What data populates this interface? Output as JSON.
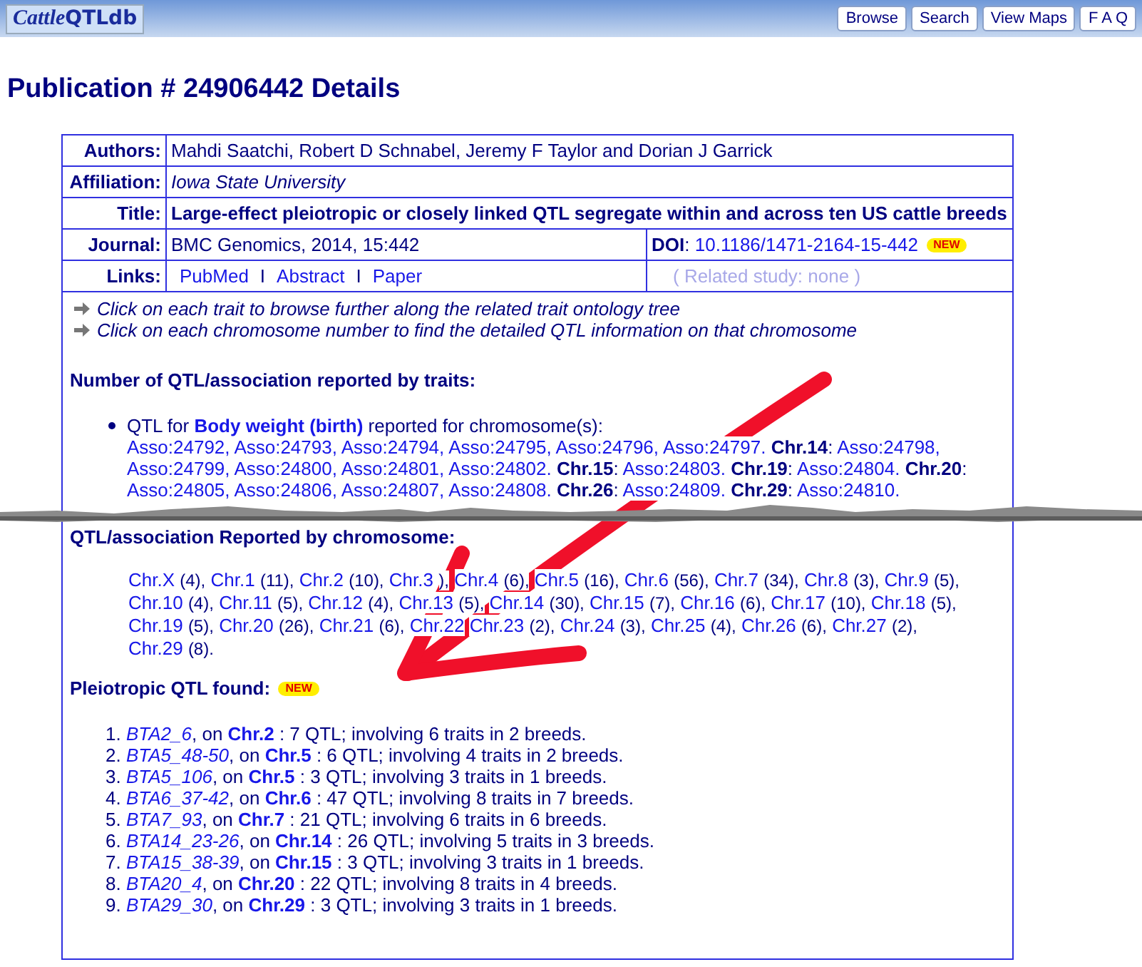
{
  "header": {
    "logo": [
      "Cattle",
      "QTLdb"
    ],
    "nav": [
      "Browse",
      "Search",
      "View Maps",
      "F A Q"
    ]
  },
  "page_title": "Publication # 24906442 Details",
  "details": {
    "authors": {
      "label": "Authors:",
      "value": "Mahdi Saatchi, Robert D Schnabel, Jeremy F Taylor and Dorian J Garrick"
    },
    "affiliation": {
      "label": "Affiliation:",
      "value": "Iowa State University"
    },
    "title": {
      "label": "Title:",
      "value": "Large-effect pleiotropic or closely linked QTL segregate within and across ten US cattle breeds"
    },
    "journal": {
      "label": "Journal:",
      "value": "BMC Genomics, 2014, 15:442"
    },
    "doi": {
      "label": "DOI",
      "colon": ":",
      "value": "10.1186/1471-2164-15-442",
      "badge": "NEW"
    },
    "links": {
      "label": "Links:",
      "items": [
        {
          "label": "PubMed"
        },
        {
          "separator": "I",
          "label": "Abstract"
        },
        {
          "separator": "I",
          "label": "Paper"
        }
      ],
      "related": "( Related study: none )"
    }
  },
  "instructions": [
    "Click on each trait to browse further along the related trait ontology tree",
    "Click on each chromosome number to find the detailed QTL information on that chromosome"
  ],
  "traits_section": {
    "heading": "Number of QTL/association reported by traits:",
    "prefix": "QTL for",
    "trait": "Body weight (birth)",
    "suffix": "reported for chromosome(s):",
    "groups": [
      {
        "assos": [
          "Asso:24792,",
          "Asso:24793,",
          "Asso:24794,",
          "Asso:24795,",
          "Asso:24796,",
          "Asso:24797."
        ]
      },
      {
        "chr": "Chr.14",
        "assos": [
          "Asso:24798,",
          "Asso:24799,",
          "Asso:24800,",
          "Asso:24801,",
          "Asso:24802."
        ]
      },
      {
        "chr": "Chr.15",
        "assos": [
          "Asso:24803."
        ]
      },
      {
        "chr": "Chr.19",
        "assos": [
          "Asso:24804."
        ]
      },
      {
        "chr": "Chr.20",
        "assos": [
          "Asso:24805,",
          "Asso:24806,",
          "Asso:24807,",
          "Asso:24808."
        ]
      },
      {
        "chr": "Chr.26",
        "assos": [
          "Asso:24809."
        ]
      },
      {
        "chr": "Chr.29",
        "assos": [
          "Asso:24810."
        ]
      }
    ],
    "colon": ":"
  },
  "chromosome_section": {
    "heading": "QTL/association Reported by chromosome:",
    "items": [
      {
        "link": "Chr.X",
        "count": "(4),"
      },
      {
        "link": "Chr.1",
        "count": "(11),"
      },
      {
        "link": "Chr.2",
        "count": "(10),"
      },
      {
        "link": "Chr.3",
        "count": "),"
      },
      {
        "link": "Chr.4",
        "count": "(6),"
      },
      {
        "link": "Chr.5",
        "count": "(16),"
      },
      {
        "link": "Chr.6",
        "count": "(56),"
      },
      {
        "link": "Chr.7",
        "count": "(34),"
      },
      {
        "link": "Chr.8",
        "count": "(3),"
      },
      {
        "link": "Chr.9",
        "count": "(5),"
      },
      {
        "link": "Chr.10",
        "count": "(4),"
      },
      {
        "link": "Chr.11",
        "count": "(5),"
      },
      {
        "link": "Chr.12",
        "count": "(4),"
      },
      {
        "link": "Chr.13",
        "count": "(5),"
      },
      {
        "link": "Chr.14",
        "count": "(30),"
      },
      {
        "link": "Chr.15",
        "count": "(7),"
      },
      {
        "link": "Chr.16",
        "count": "(6),"
      },
      {
        "link": "Chr.17",
        "count": "(10),"
      },
      {
        "link": "Chr.18",
        "count": "(5),"
      },
      {
        "link": "Chr.19",
        "count": "(5),"
      },
      {
        "link": "Chr.20",
        "count": "(26),"
      },
      {
        "link": "Chr.21",
        "count": "(6),"
      },
      {
        "link": "Chr.22"
      },
      {
        "link": "Chr.23",
        "count": "(2),"
      },
      {
        "link": "Chr.24",
        "count": "(3),"
      },
      {
        "link": "Chr.25",
        "count": "(4),"
      },
      {
        "link": "Chr.26",
        "count": "(6),"
      },
      {
        "link": "Chr.27",
        "count": "(2),"
      },
      {
        "link": "Chr.29",
        "count": "(8)."
      }
    ]
  },
  "pleiotropic_section": {
    "heading": "Pleiotropic QTL found:",
    "badge": "NEW",
    "items": [
      {
        "num": "1.",
        "name": "BTA2_6",
        "on": ", on",
        "chr": "Chr.2",
        "summary": ": 7 QTL; involving 6 traits in 2 breeds."
      },
      {
        "num": "2.",
        "name": "BTA5_48-50",
        "on": ", on",
        "chr": "Chr.5",
        "summary": ": 6 QTL; involving 4 traits in 2 breeds."
      },
      {
        "num": "3.",
        "name": "BTA5_106",
        "on": ", on",
        "chr": "Chr.5",
        "summary": ": 3 QTL; involving 3 traits in 1 breeds."
      },
      {
        "num": "4.",
        "name": "BTA6_37-42",
        "on": ", on",
        "chr": "Chr.6",
        "summary": ": 47 QTL; involving 8 traits in 7 breeds."
      },
      {
        "num": "5.",
        "name": "BTA7_93",
        "on": ", on",
        "chr": "Chr.7",
        "summary": ": 21 QTL; involving 6 traits in 6 breeds."
      },
      {
        "num": "6.",
        "name": "BTA14_23-26",
        "on": ", on",
        "chr": "Chr.14",
        "summary": ": 26 QTL; involving 5 traits in 3 breeds."
      },
      {
        "num": "7.",
        "name": "BTA15_38-39",
        "on": ", on",
        "chr": "Chr.15",
        "summary": ": 3 QTL; involving 3 traits in 1 breeds."
      },
      {
        "num": "8.",
        "name": "BTA20_4",
        "on": ", on",
        "chr": "Chr.20",
        "summary": ": 22 QTL; involving 8 traits in 4 breeds."
      },
      {
        "num": "9.",
        "name": "BTA29_30",
        "on": ", on",
        "chr": "Chr.29",
        "summary": ": 3 QTL; involving 3 traits in 1 breeds."
      }
    ]
  }
}
